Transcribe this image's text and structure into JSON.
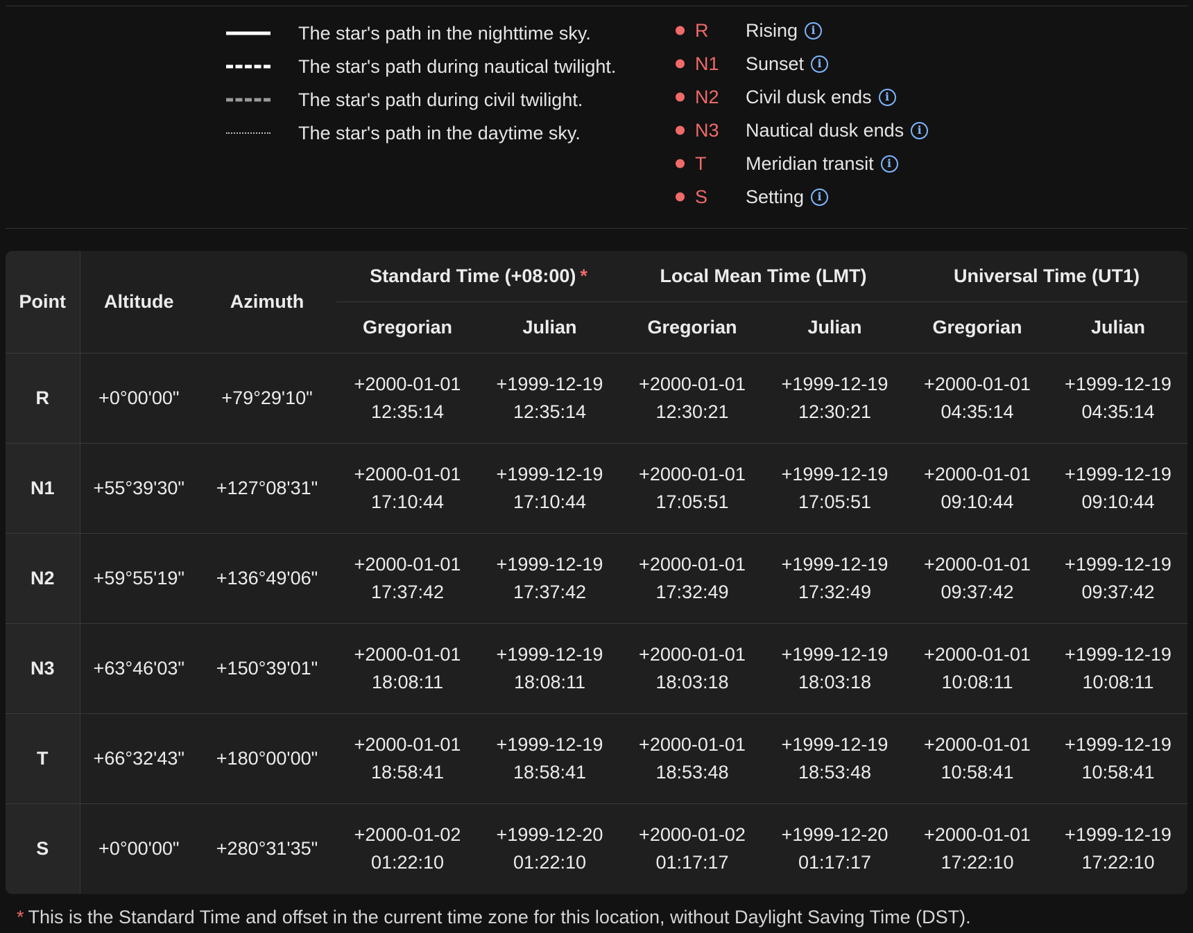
{
  "legend": {
    "lines": [
      {
        "style": "solid",
        "text": "The star's path in the nighttime sky."
      },
      {
        "style": "dashed",
        "text": "The star's path during nautical twilight."
      },
      {
        "style": "civil",
        "text": "The star's path during civil twilight."
      },
      {
        "style": "dotted",
        "text": "The star's path in the daytime sky."
      }
    ],
    "points": [
      {
        "code": "R",
        "label": "Rising"
      },
      {
        "code": "N1",
        "label": "Sunset"
      },
      {
        "code": "N2",
        "label": "Civil dusk ends"
      },
      {
        "code": "N3",
        "label": "Nautical dusk ends"
      },
      {
        "code": "T",
        "label": "Meridian transit"
      },
      {
        "code": "S",
        "label": "Setting"
      }
    ],
    "info_icon": "info-circle-icon",
    "point_color": "#f06a6a",
    "info_color": "#7fb6ff"
  },
  "table": {
    "headers": {
      "point": "Point",
      "altitude": "Altitude",
      "azimuth": "Azimuth",
      "standard_time": "Standard Time (+08:00)",
      "asterisk": "*",
      "lmt": "Local Mean Time (LMT)",
      "ut1": "Universal Time (UT1)",
      "gregorian": "Gregorian",
      "julian": "Julian"
    },
    "rows": [
      {
        "point": "R",
        "altitude": "+0°00'00\"",
        "azimuth": "+79°29'10\"",
        "std_greg_date": "+2000-01-01",
        "std_greg_time": "12:35:14",
        "std_jul_date": "+1999-12-19",
        "std_jul_time": "12:35:14",
        "lmt_greg_date": "+2000-01-01",
        "lmt_greg_time": "12:30:21",
        "lmt_jul_date": "+1999-12-19",
        "lmt_jul_time": "12:30:21",
        "ut_greg_date": "+2000-01-01",
        "ut_greg_time": "04:35:14",
        "ut_jul_date": "+1999-12-19",
        "ut_jul_time": "04:35:14"
      },
      {
        "point": "N1",
        "altitude": "+55°39'30\"",
        "azimuth": "+127°08'31\"",
        "std_greg_date": "+2000-01-01",
        "std_greg_time": "17:10:44",
        "std_jul_date": "+1999-12-19",
        "std_jul_time": "17:10:44",
        "lmt_greg_date": "+2000-01-01",
        "lmt_greg_time": "17:05:51",
        "lmt_jul_date": "+1999-12-19",
        "lmt_jul_time": "17:05:51",
        "ut_greg_date": "+2000-01-01",
        "ut_greg_time": "09:10:44",
        "ut_jul_date": "+1999-12-19",
        "ut_jul_time": "09:10:44"
      },
      {
        "point": "N2",
        "altitude": "+59°55'19\"",
        "azimuth": "+136°49'06\"",
        "std_greg_date": "+2000-01-01",
        "std_greg_time": "17:37:42",
        "std_jul_date": "+1999-12-19",
        "std_jul_time": "17:37:42",
        "lmt_greg_date": "+2000-01-01",
        "lmt_greg_time": "17:32:49",
        "lmt_jul_date": "+1999-12-19",
        "lmt_jul_time": "17:32:49",
        "ut_greg_date": "+2000-01-01",
        "ut_greg_time": "09:37:42",
        "ut_jul_date": "+1999-12-19",
        "ut_jul_time": "09:37:42"
      },
      {
        "point": "N3",
        "altitude": "+63°46'03\"",
        "azimuth": "+150°39'01\"",
        "std_greg_date": "+2000-01-01",
        "std_greg_time": "18:08:11",
        "std_jul_date": "+1999-12-19",
        "std_jul_time": "18:08:11",
        "lmt_greg_date": "+2000-01-01",
        "lmt_greg_time": "18:03:18",
        "lmt_jul_date": "+1999-12-19",
        "lmt_jul_time": "18:03:18",
        "ut_greg_date": "+2000-01-01",
        "ut_greg_time": "10:08:11",
        "ut_jul_date": "+1999-12-19",
        "ut_jul_time": "10:08:11"
      },
      {
        "point": "T",
        "altitude": "+66°32'43\"",
        "azimuth": "+180°00'00\"",
        "std_greg_date": "+2000-01-01",
        "std_greg_time": "18:58:41",
        "std_jul_date": "+1999-12-19",
        "std_jul_time": "18:58:41",
        "lmt_greg_date": "+2000-01-01",
        "lmt_greg_time": "18:53:48",
        "lmt_jul_date": "+1999-12-19",
        "lmt_jul_time": "18:53:48",
        "ut_greg_date": "+2000-01-01",
        "ut_greg_time": "10:58:41",
        "ut_jul_date": "+1999-12-19",
        "ut_jul_time": "10:58:41"
      },
      {
        "point": "S",
        "altitude": "+0°00'00\"",
        "azimuth": "+280°31'35\"",
        "std_greg_date": "+2000-01-02",
        "std_greg_time": "01:22:10",
        "std_jul_date": "+1999-12-20",
        "std_jul_time": "01:22:10",
        "lmt_greg_date": "+2000-01-02",
        "lmt_greg_time": "01:17:17",
        "lmt_jul_date": "+1999-12-20",
        "lmt_jul_time": "01:17:17",
        "ut_greg_date": "+2000-01-01",
        "ut_greg_time": "17:22:10",
        "ut_jul_date": "+1999-12-19",
        "ut_jul_time": "17:22:10"
      }
    ]
  },
  "footnote": {
    "asterisk": "*",
    "text": "This is the Standard Time and offset in the current time zone for this location, without Daylight Saving Time (DST)."
  }
}
